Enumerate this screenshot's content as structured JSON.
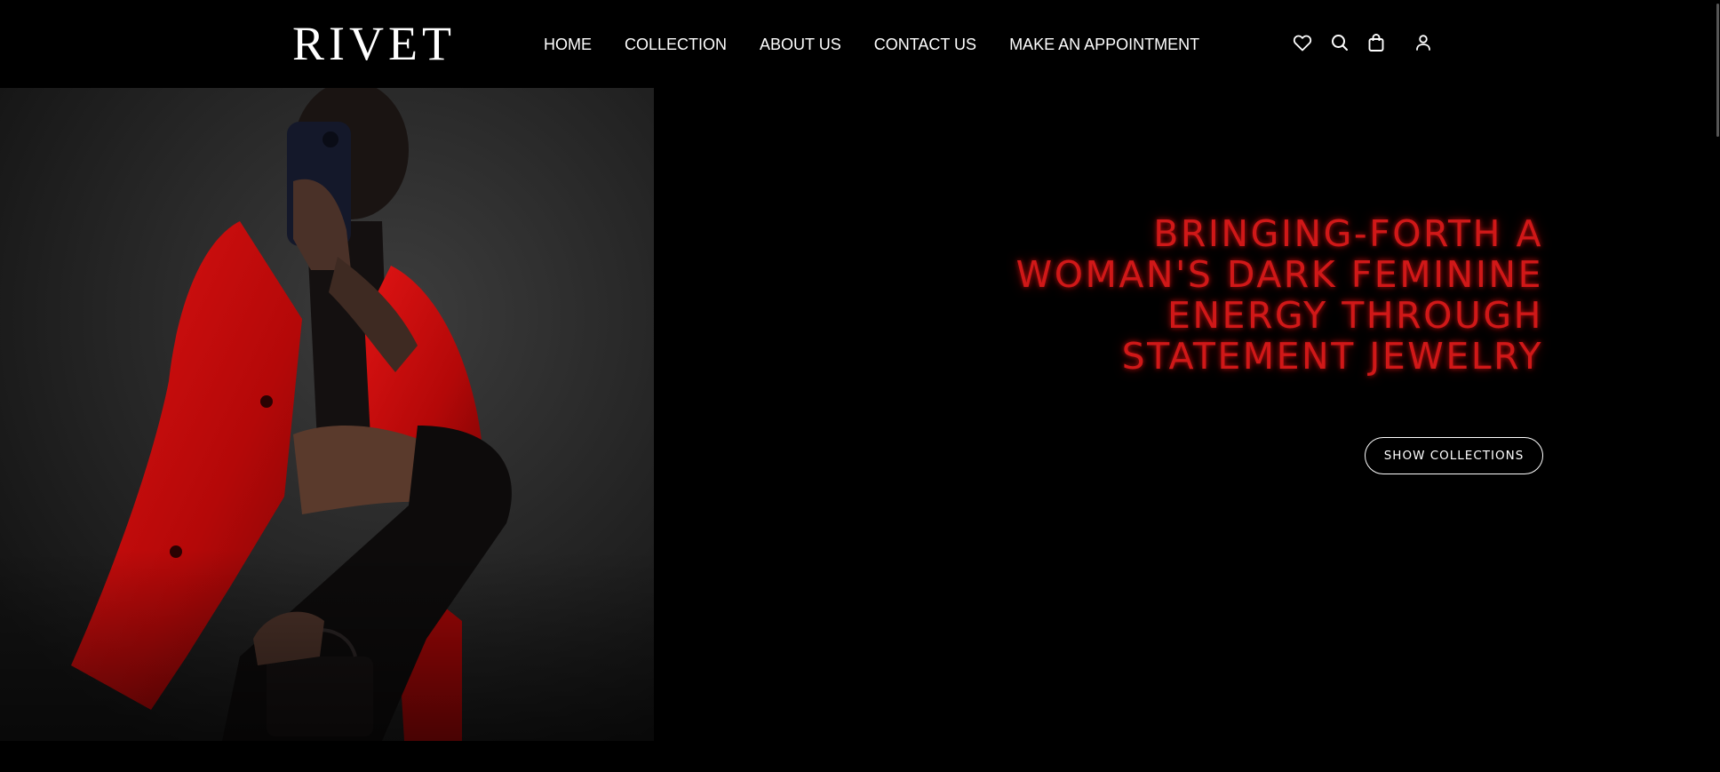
{
  "brand": {
    "logo_text": "RIVET"
  },
  "nav": {
    "items": [
      {
        "label": "HOME"
      },
      {
        "label": "COLLECTION"
      },
      {
        "label": "ABOUT US"
      },
      {
        "label": "CONTACT US"
      },
      {
        "label": "MAKE AN APPOINTMENT"
      }
    ]
  },
  "header_icons": [
    "heart-icon",
    "search-icon",
    "shopping-bag-icon",
    "user-icon"
  ],
  "hero": {
    "headline_lines": [
      "BRINGING-FORTH A",
      "WOMAN'S DARK FEMININE",
      "ENERGY THROUGH",
      "STATEMENT JEWELRY"
    ],
    "cta_label": "SHOW COLLECTIONS",
    "photo_description": "woman in red blazer and black boots taking mirror selfie"
  },
  "colors": {
    "background": "#000000",
    "headline": "#d01818",
    "text": "#ffffff",
    "blazer_red": "#c80d0d"
  }
}
